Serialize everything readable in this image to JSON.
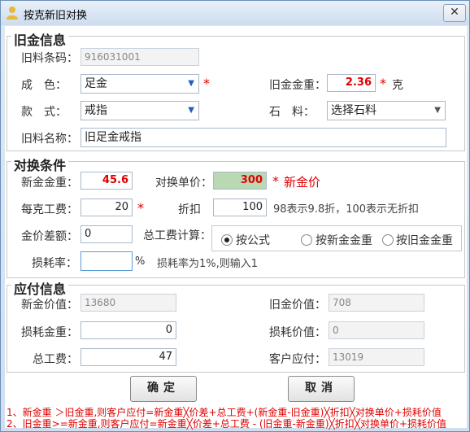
{
  "window": {
    "title": "按克新旧对换",
    "close_label": "✕"
  },
  "old_gold": {
    "legend": "旧金信息",
    "barcode_label": "旧料条码：",
    "barcode_value": "916031001",
    "color_label": "成　色：",
    "color_value": "足金",
    "weight_label": "旧金金重：",
    "weight_value": "2.36",
    "weight_unit": "克",
    "style_label": "款　式：",
    "style_value": "戒指",
    "stone_label": "石　料：",
    "stone_value": "选择石料",
    "name_label": "旧料名称：",
    "name_value": "旧足金戒指"
  },
  "exchange": {
    "legend": "对换条件",
    "new_weight_label": "新金金重：",
    "new_weight_value": "45.6",
    "unit_price_label": "对换单价：",
    "unit_price_value": "300",
    "unit_price_note": "新金价",
    "labor_per_gram_label": "每克工费：",
    "labor_per_gram_value": "20",
    "discount_label": "折扣",
    "discount_value": "100",
    "discount_hint": "98表示9.8折，100表示无折扣",
    "price_diff_label": "金价差额：",
    "price_diff_value": "0",
    "total_labor_calc_label": "总工费计算：",
    "radio_formula": "按公式",
    "radio_new_weight": "按新金金重",
    "radio_old_weight": "按旧金金重",
    "loss_rate_label": "损耗率：",
    "loss_rate_value": "",
    "loss_rate_unit": "%",
    "loss_rate_hint": "损耗率为1%,则输入1"
  },
  "payment": {
    "legend": "应付信息",
    "new_value_label": "新金价值：",
    "new_value": "13680",
    "old_value_label": "旧金价值：",
    "old_value": "708",
    "loss_weight_label": "损耗金重：",
    "loss_weight": "0",
    "loss_value_label": "损耗价值：",
    "loss_value": "0",
    "total_labor_label": "总工费：",
    "total_labor": "47",
    "customer_pay_label": "客户应付：",
    "customer_pay": "13019"
  },
  "buttons": {
    "confirm": "确定",
    "cancel": "取消"
  },
  "notes": {
    "line1": "1、新金重 ＞旧金重,则客户应付=新金重╳价差+总工费+(新金重-旧金重)╳折扣╳对换单价+损耗价值",
    "line2": "2、旧金重>=新金重,则客户应付=新金重╳价差+总工费 - (旧金重-新金重)╳折扣╳对换单价+损耗价值"
  }
}
